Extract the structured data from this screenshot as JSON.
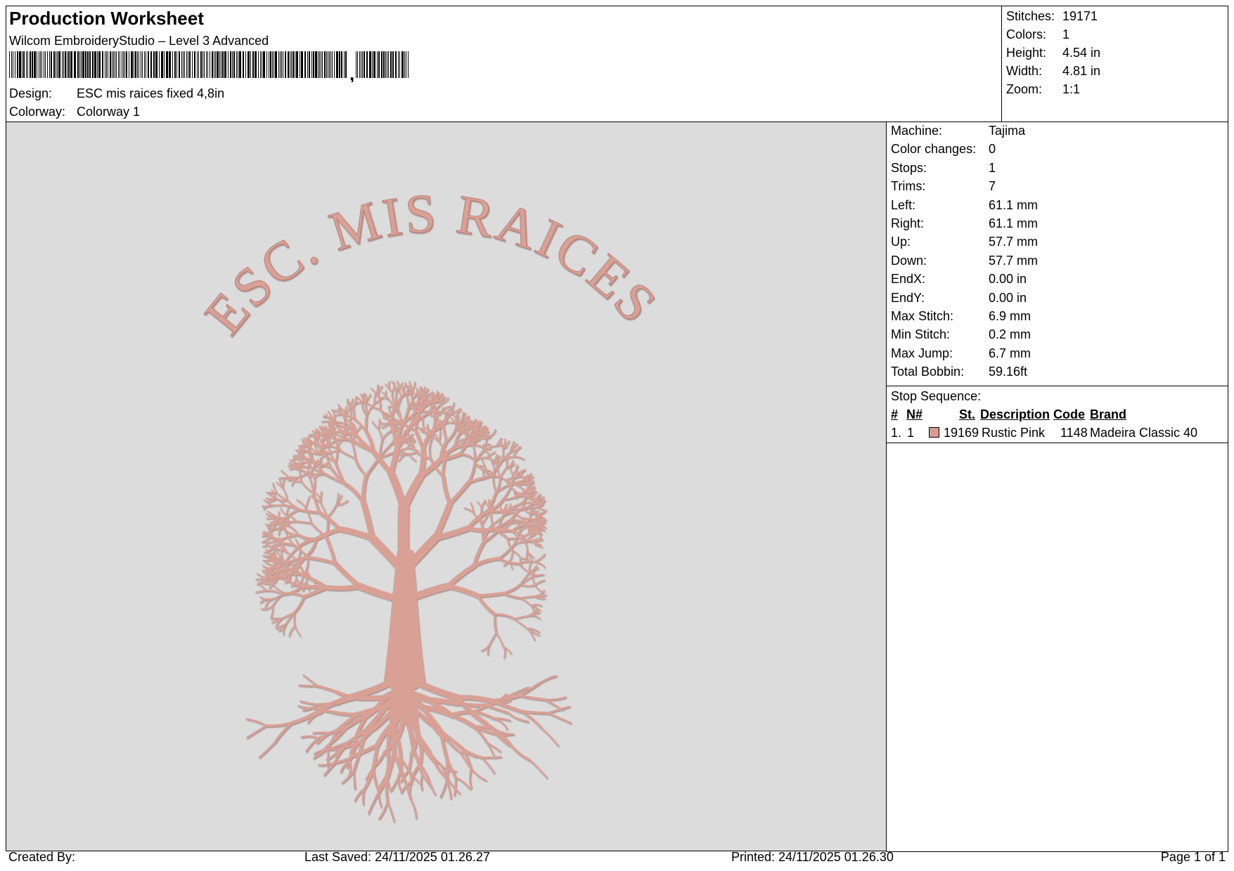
{
  "header": {
    "title": "Production Worksheet",
    "software": "Wilcom EmbroideryStudio – Level 3 Advanced",
    "barcode_suffix": ",",
    "design_label": "Design:",
    "design_value": "ESC mis raices fixed 4,8in",
    "colorway_label": "Colorway:",
    "colorway_value": "Colorway 1"
  },
  "summary": [
    {
      "label": "Stitches:",
      "value": "19171"
    },
    {
      "label": "Colors:",
      "value": "1"
    },
    {
      "label": "Height:",
      "value": "4.54 in"
    },
    {
      "label": "Width:",
      "value": "4.81 in"
    },
    {
      "label": "Zoom:",
      "value": "1:1"
    }
  ],
  "stats": [
    {
      "label": "Machine:",
      "value": "Tajima"
    },
    {
      "label": "Color changes:",
      "value": "0"
    },
    {
      "label": "Stops:",
      "value": "1"
    },
    {
      "label": "Trims:",
      "value": "7"
    },
    {
      "label": "Left:",
      "value": "61.1 mm"
    },
    {
      "label": "Right:",
      "value": "61.1 mm"
    },
    {
      "label": "Up:",
      "value": "57.7 mm"
    },
    {
      "label": "Down:",
      "value": "57.7 mm"
    },
    {
      "label": "EndX:",
      "value": "0.00 in"
    },
    {
      "label": "EndY:",
      "value": "0.00 in"
    },
    {
      "label": "Max Stitch:",
      "value": "6.9 mm"
    },
    {
      "label": "Min Stitch:",
      "value": "0.2 mm"
    },
    {
      "label": "Max Jump:",
      "value": "6.7 mm"
    },
    {
      "label": "Total Bobbin:",
      "value": "59.16ft"
    }
  ],
  "stop_sequence": {
    "title": "Stop Sequence:",
    "columns": {
      "num": "#",
      "needle": "N#",
      "stitches": "St.",
      "description": "Description",
      "code": "Code",
      "brand": "Brand"
    },
    "rows": [
      {
        "num": "1.",
        "needle": "1",
        "swatch_color": "#d99a94",
        "stitches": "19169",
        "description": "Rustic Pink",
        "code": "1148",
        "brand": "Madeira Classic 40"
      }
    ]
  },
  "design_preview": {
    "arc_text": "ESC. MIS RAICES",
    "thread_color": "#d9a196",
    "background_color": "#dcdcdc"
  },
  "footer": {
    "created_by": "Created By:",
    "last_saved": "Last Saved: 24/11/2025 01.26.27",
    "printed": "Printed: 24/11/2025 01.26.30",
    "page": "Page 1 of 1"
  }
}
